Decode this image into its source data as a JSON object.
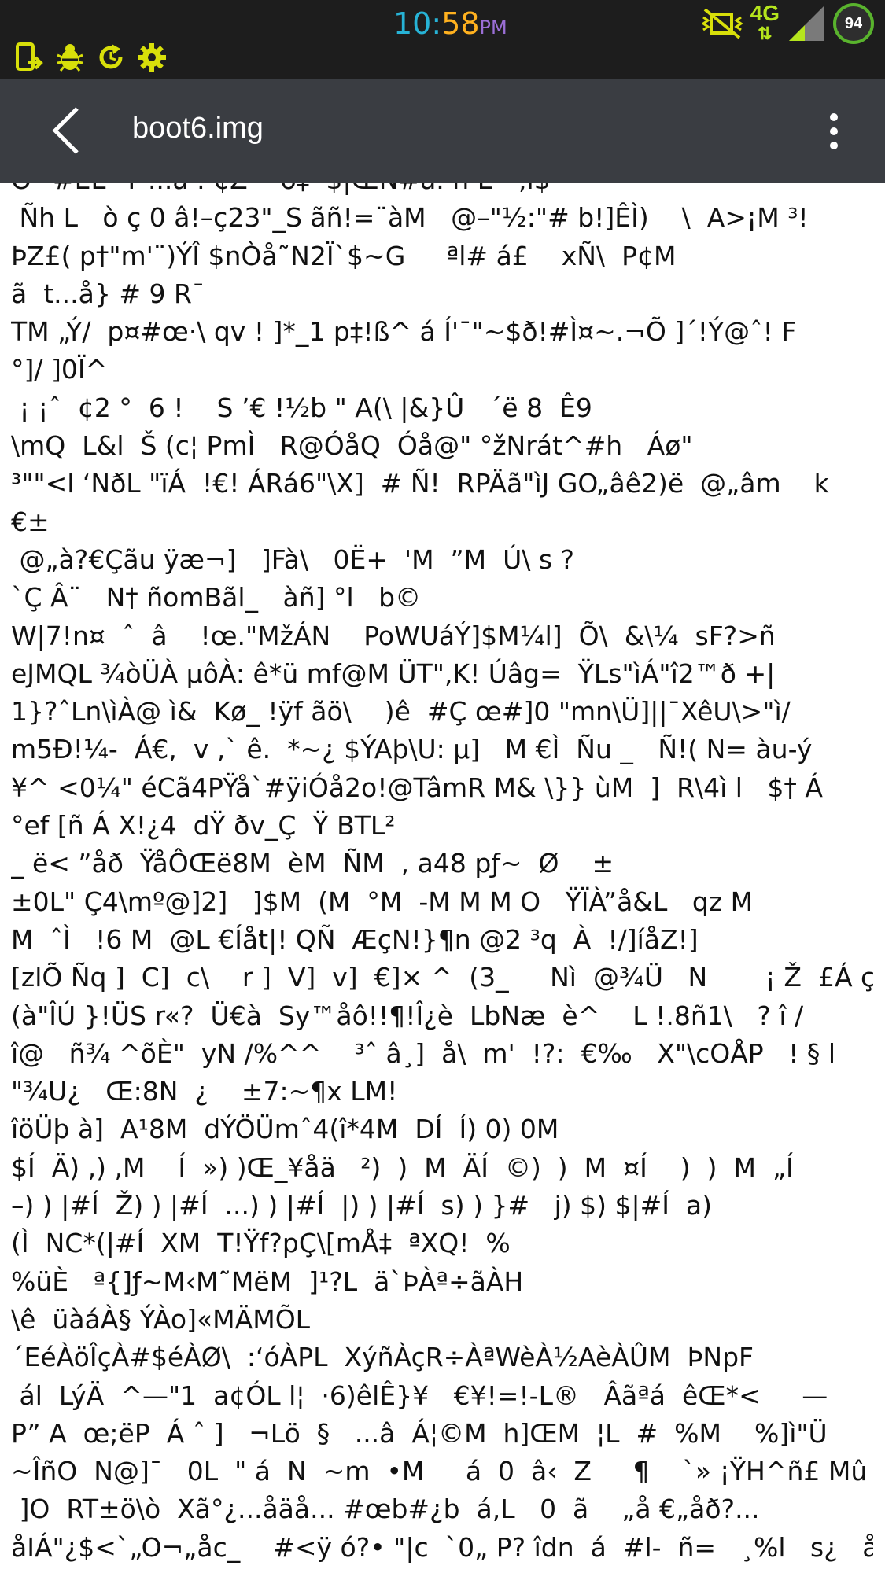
{
  "status_bar": {
    "time_hours": "10:",
    "time_minutes": "58",
    "time_ampm": "PM",
    "network": "4G",
    "network_arrows": "⇅",
    "battery": "94",
    "left_icons": [
      "phone-screenshot-icon",
      "bug-icon",
      "refresh-icon",
      "gear-icon"
    ],
    "colors": {
      "icon_accent": "#d8df0a",
      "network": "#b5e51d",
      "battery_ring": "#59b32d"
    }
  },
  "app_bar": {
    "title": "boot6.img",
    "background": "#3a3d42"
  },
  "content": {
    "lines": [
      "Õ ¯#ÊÈ  Ý ...à . ¢Z    õ‡  $|ŒN#â. ñ Ë   ,ı$",
      " Ñh L   ò ç 0 â!–ç23\"_S ãñ!=¨àM   @–\"½:\"# b!]ÊÌ)    \\  A>¡M ³!",
      "ÞZ£( p†\"m'¨)ÝÎ $nÒå˜N2Ï`$~G     ªl# á£    xÑ\\  P¢M",
      "ã  t...å} # 9 R¯",
      "TM „Ý/  p¤#œ·\\ qv ! ]*_1 p‡!ß^ á Í'¯\"~$ð!#Ì¤~.¬Õ ]´!Ý@ˆ! F",
      "°]/ ]0Ï^",
      " ¡ ¡ˆ  ¢2 °  6 !    S ’€ !½b \" A(\\ |&}Û   ´ë 8  Ê9",
      "\\mQ  L&l  Š (c¦ PmÌ   R@ÓåQ  Óå@\" °žNrát^#h   Áø\"",
      "³\"\"<l ‘NðL \"ïÁ  !€! ÁRá6\"\\X]  # Ñ!  RPÄã\"ìJ GO„âê2)ë  @„âm    k",
      "€±",
      " @„à?€Çãu ÿæ¬]   ]Fà\\   0Ë+  'M  ”M  Ú\\ s ?",
      "`Ç Â¨   N† ñomBãl_   àñ] °l   b©",
      "W|7!n¤  ˆ  â    !œ.\"MžÁN    PoWUáÝ]$M¼l]  Õ\\  &\\¼  sF?>ñ",
      "eJMQL ¾òÜÀ µôÀ: ê*ü mf@M ÜT\",K! Úâg=  ŸLs\"ìÁ\"î2™ð +|",
      "1}?ˆLn\\ìÀ@ ì&  Kø_ !ÿf ãö\\    )ê  #Ç œ#]0 \"mn\\Ü]||¯XêU\\>\"ì/",
      "m5Ð!¼-  Á€,  v ,` ê.  *~¿ $ÝAþ\\U: µ]   M €Ì  Ñu _   Ñ!( N= àu-ý",
      "¥^ <0¼\" éCã4PŸå`#ÿiÓå2o!@TâmR M& \\}} ùM  ]  R\\4ì l   $† Á",
      "°ef [ñ Á X!¿4  dŸ ðv_Ç  Ÿ BTL²",
      "_ ë< ”åð  ŸåÔŒë8M  èM  ÑM  , a48 pƒ~  Ø    ±",
      "±0L\" Ç4\\mº@]2]   ]$M  (M  °M  -M M M O   ŸÏÀ”å&L   qz M",
      "M  ˆÌ   !6 M  @L €Íåt|! QÑ  ÆçN!}¶n @2 ³q  À  !/]íåZ!]",
      "[zlÕ Ñq ]  C]  c\\    r ]  V]  v]  €]× ^  (3_     Nì  @¾Ü   N       ¡ Ž  £Á ç !",
      "(à\"ÎÚ }!ÜS r«?  Ü€à  Sy™åô!!¶!Î¿è  LbNæ  è^    L !.8ñ1\\   ? î /",
      "î@   ñ¾ ^õÈ\"  yN /%^^    ³ˆ â¸]  å\\  m'  !?:  €‰   X\"\\cOÅP   ! § l",
      "\"¾U¿   Œ:8N  ¿    ±7:~¶x LM!",
      "îöÜþ à]  A¹8M  dÝÖÜmˆ4(î*4M  DÍ  Í) 0) 0M",
      "$Í  Ä) ,) ,M    Í  ») )Œ_¥åä   ²)  )  M  ÄÍ  ©)  )  M  ¤Í    )  )  M  „Í",
      "–) ) |#Í  Ž) ) |#Í  ...) ) |#Í  |) ) |#Í  s) ) }#   j) $) $|#Í  a)",
      "(Ì  NC*(|#Í  XM  T!Ÿf?pÇ\\[mÅ‡  ªXQ!  %",
      "%üÈ   ª{]ƒ~M‹M˜MëM  ]¹?L  ä`ÞÀª÷ãÀH",
      "\\ê  üàáÀ§ ÝÀo]«MÄMÕL",
      "´EéÀöÎçÀ#$éÀØ\\  :‘óÀPL  XýñÀçR÷ÀªWèÀ½AèÀÛM  ÞNpF",
      " ál  LýÄ  ^—\"1  a¢ÓL l¦  ·6)êlÊ}¥   €¥!=!-L®   Âãªá  êŒ*<     —",
      "P” A  œ;ëP  Á ˆ ]   ¬Lö  §   ...â  Á¦©M  h]ŒM  ¦L  #  %M    %]ì\"Ü",
      "~ÎñO  N@]¯   0L  \" á  N  ~m  •M     á  0  â‹  Z     ¶    `» ¡ŸH^ñ£ Mû",
      " ]O  RT±ö\\ò  Xã°¿...åäå... #œb#¿b  á,L   0  ã    „å €„åð?...",
      "åIÁ\"¿$<`„O¬„åc_    #<ÿ ó?• \"|c  `0„ P? îdn  á  #l-  ñ=   ¸%l   s¿   ål \""
    ]
  }
}
